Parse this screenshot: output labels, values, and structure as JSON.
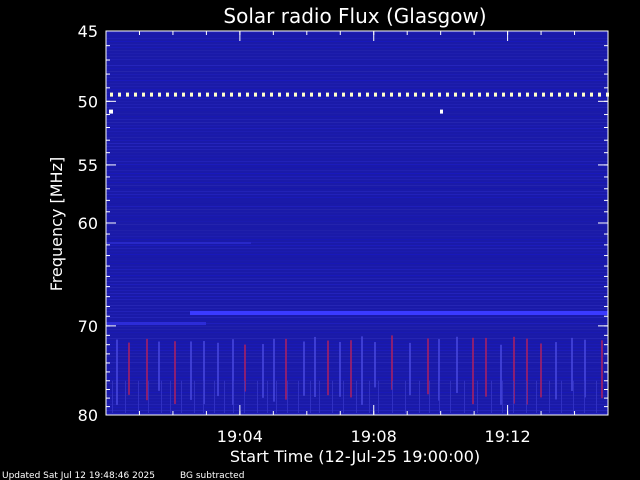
{
  "chart_data": {
    "type": "heatmap",
    "title": "Solar radio Flux (Glasgow)",
    "xlabel": "Start Time (12-Jul-25 19:00:00)",
    "ylabel": "Frequency [MHz]",
    "x_range_minutes": [
      0,
      15.0
    ],
    "x_ticks": [
      {
        "label": "19:04",
        "minute": 4
      },
      {
        "label": "19:08",
        "minute": 8
      },
      {
        "label": "19:12",
        "minute": 12
      }
    ],
    "y_range_mhz": [
      45,
      80
    ],
    "y_scale": "log",
    "y_ticks": [
      {
        "label": "45",
        "mhz": 45
      },
      {
        "label": "50",
        "mhz": 50
      },
      {
        "label": "55",
        "mhz": 55
      },
      {
        "label": "60",
        "mhz": 60
      },
      {
        "label": "70",
        "mhz": 70
      },
      {
        "label": "80",
        "mhz": 80
      }
    ],
    "colors": {
      "background": "#1a1aa8",
      "interference_line": "#ffffcc",
      "band": "#3a3aff",
      "spikes": "#b02060"
    },
    "features": {
      "bright_interference_line_mhz": 49.5,
      "horizontal_band_mhz": 70.5,
      "spike_region_mhz": [
        71,
        79
      ]
    }
  },
  "footer": {
    "updated": "Updated Sat Jul 12 19:48:46 2025",
    "bg_note": "BG subtracted"
  }
}
